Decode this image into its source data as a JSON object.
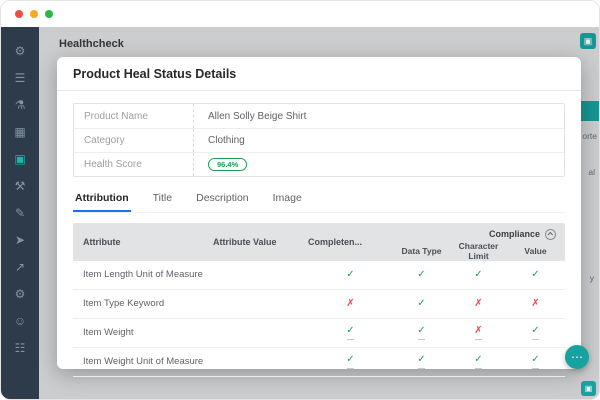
{
  "colors": {
    "accent_teal": "#17a2a0",
    "pass": "#21a04a",
    "fail": "#e14b4b",
    "tab_active": "#1a73e8",
    "sidebar_bg": "#2d3b4b"
  },
  "window": {
    "controls": [
      {
        "name": "close",
        "color": "#ef4d43"
      },
      {
        "name": "minimize",
        "color": "#f6a923"
      },
      {
        "name": "zoom",
        "color": "#2ab748"
      }
    ]
  },
  "sidebar": {
    "items": [
      {
        "name": "settings",
        "glyph": "⚙"
      },
      {
        "name": "data",
        "glyph": "☰"
      },
      {
        "name": "lab",
        "glyph": "⚗"
      },
      {
        "name": "apps",
        "glyph": "▦"
      },
      {
        "name": "products",
        "glyph": "▣"
      },
      {
        "name": "tools",
        "glyph": "⚒"
      },
      {
        "name": "edit",
        "glyph": "✎"
      },
      {
        "name": "publish",
        "glyph": "➤"
      },
      {
        "name": "export",
        "glyph": "↗"
      },
      {
        "name": "config",
        "glyph": "⚙"
      },
      {
        "name": "account",
        "glyph": "☺"
      },
      {
        "name": "teams",
        "glyph": "☷"
      }
    ]
  },
  "header": {
    "title": "Healthcheck",
    "app_icon_glyph": "▣"
  },
  "background": {
    "fragments": [
      {
        "text": "orte"
      },
      {
        "text": "al"
      },
      {
        "text": "y"
      }
    ]
  },
  "modal": {
    "title": "Product Heal Status Details",
    "info": {
      "rows": [
        {
          "label": "Product Name",
          "value": "Allen Solly Beige Shirt"
        },
        {
          "label": "Category",
          "value": "Clothing"
        },
        {
          "label": "Health Score",
          "value": "96.4%"
        }
      ]
    },
    "tabs": [
      {
        "label": "Attribution",
        "active": true
      },
      {
        "label": "Title",
        "active": false
      },
      {
        "label": "Description",
        "active": false
      },
      {
        "label": "Image",
        "active": false
      }
    ],
    "table": {
      "compliance_label": "Compliance",
      "headers": {
        "attribute": "Attribute",
        "attribute_value": "Attribute Value",
        "completeness": "Completen...",
        "sub": [
          "Data Type",
          "Character Limit",
          "Value"
        ]
      },
      "rows": [
        {
          "attribute": "Item Length Unit of Measure",
          "attribute_value": "",
          "marks": [
            "✓",
            "✓",
            "✓",
            "✓"
          ]
        },
        {
          "attribute": "Item Type Keyword",
          "attribute_value": "",
          "marks": [
            "✗",
            "✓",
            "✗",
            "✗"
          ]
        },
        {
          "attribute": "Item Weight",
          "attribute_value": "",
          "marks": [
            "✓",
            "✓",
            "✗",
            "✓"
          ]
        },
        {
          "attribute": "Item Weight Unit of Measure",
          "attribute_value": "",
          "marks": [
            "✓",
            "✓",
            "✓",
            "✓"
          ]
        }
      ]
    }
  },
  "fab": {
    "chat_glyph": "⋯"
  },
  "corner": {
    "cube_glyph": "▣"
  }
}
